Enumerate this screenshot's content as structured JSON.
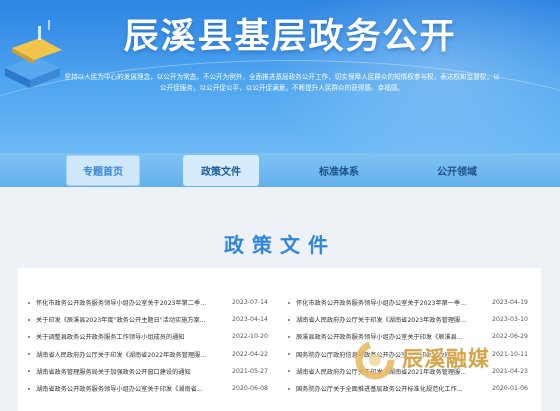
{
  "header": {
    "title": "辰溪县基层政务公开",
    "slogan": "坚持以人民为中心的发展理念，以公开为常态，不公开为例外，全面推进基层政务公开工作，切实保障人民群众的知情权参与权，表达权和监督权，以公开促服务，以公开促公平，以公开促满意，不断提升人民群众的获得感、幸福感。"
  },
  "nav": {
    "items": [
      {
        "label": "专题首页"
      },
      {
        "label": "政策文件"
      },
      {
        "label": "标准体系"
      },
      {
        "label": "公开领域"
      }
    ]
  },
  "section": {
    "title": "政策文件"
  },
  "policies": {
    "left": [
      {
        "title": "怀化市政务公开政务服务领导小组办公室关于2023年第二季...",
        "date": "2023-07-14"
      },
      {
        "title": "关于印发《辰溪县2023年度\"政务公开主题日\"活动实施方案...",
        "date": "2023-04-14"
      },
      {
        "title": "关于调整县政务公开政务服务工作领导小组成员的通知",
        "date": "2022-10-20"
      },
      {
        "title": "湖南省人民政府办公厅关于印发《湖南省2022年政务管理服...",
        "date": "2022-04-22"
      },
      {
        "title": "湖南省政务管理服务局关于加强政务公开窗口建设的通知",
        "date": "2021-05-27"
      },
      {
        "title": "湖南省政务公开政务服务领导小组办公室关于印发《湖南省...",
        "date": "2020-06-08"
      }
    ],
    "right": [
      {
        "title": "怀化市政务公开政务服务领导小组办公室关于2023年第一季...",
        "date": "2023-04-19"
      },
      {
        "title": "湖南省人民政府办公厅关于印发《湖南省2023年政务管理服...",
        "date": "2023-03-10"
      },
      {
        "title": "辰溪县政务公开政务服务领导小组办公室关于印发《辰溪县...",
        "date": "2022-06-29"
      },
      {
        "title": "国务院办公厅政府信息与政务公开办公室关于印发《政府...",
        "date": "2021-10-11"
      },
      {
        "title": "湖南省人民政府办公厅关于印发《湖南省2021年政务管理服...",
        "date": "2021-04-23"
      },
      {
        "title": "国务院办公厅关于全面推进基层政务公开标准化规范化工作...",
        "date": "2020-01-06"
      }
    ]
  },
  "watermark": {
    "text": "辰溪融媒"
  },
  "colors": {
    "banner": "#3d95ea",
    "nav_bar": "#74bbf0",
    "section_title": "#2f86db",
    "watermark": "#d6a44a"
  }
}
